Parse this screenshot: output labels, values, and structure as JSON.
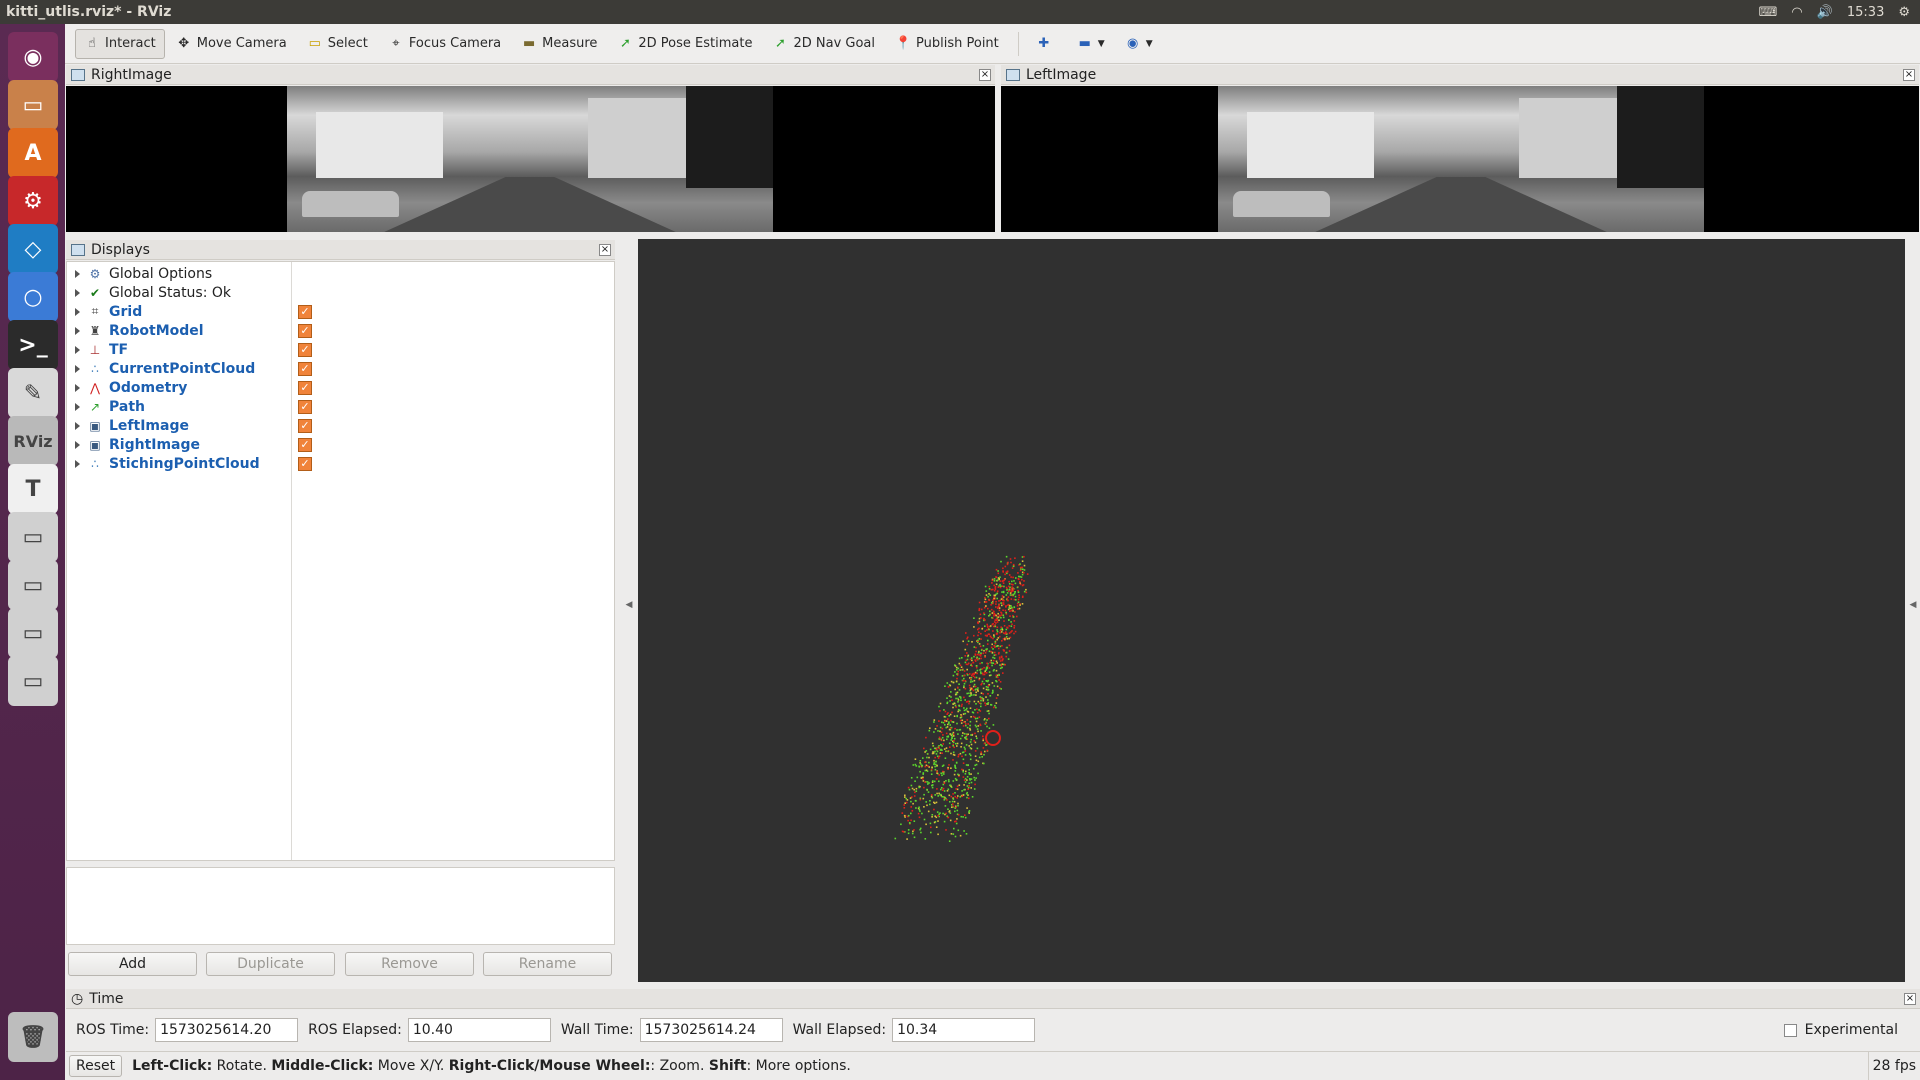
{
  "window": {
    "title": "kitti_utlis.rviz* - RViz"
  },
  "tray": {
    "clock": "15:33",
    "icons": [
      "keyboard-icon",
      "wifi-icon",
      "volume-icon",
      "settings-gear-icon"
    ]
  },
  "launcher": {
    "items": [
      {
        "name": "ubuntu-dash",
        "glyph": "◉",
        "color": "#7a2f5e"
      },
      {
        "name": "files",
        "glyph": "▭",
        "color": "#c9814a"
      },
      {
        "name": "software-center",
        "glyph": "A",
        "color": "#e06a1e"
      },
      {
        "name": "system-settings",
        "glyph": "⚙",
        "color": "#c7282a"
      },
      {
        "name": "vscode",
        "glyph": "◇",
        "color": "#1f7dc4"
      },
      {
        "name": "chromium",
        "glyph": "○",
        "color": "#3b7bd6"
      },
      {
        "name": "terminal",
        "glyph": ">_",
        "color": "#2b2b2b"
      },
      {
        "name": "text-editor",
        "glyph": "✎",
        "color": "#d9d9d9"
      },
      {
        "name": "rviz",
        "glyph": "RViz",
        "color": "#b9b9b9"
      },
      {
        "name": "typora",
        "glyph": "T",
        "color": "#f0f0f0"
      },
      {
        "name": "drive-1",
        "glyph": "▭",
        "color": "#d0d0d0"
      },
      {
        "name": "drive-2",
        "glyph": "▭",
        "color": "#d0d0d0"
      },
      {
        "name": "drive-3",
        "glyph": "▭",
        "color": "#d0d0d0"
      },
      {
        "name": "drive-4",
        "glyph": "▭",
        "color": "#d0d0d0"
      },
      {
        "name": "trash",
        "glyph": "🗑",
        "color": "#bdbdbd"
      }
    ]
  },
  "toolbar": {
    "interact": "Interact",
    "move_camera": "Move Camera",
    "select": "Select",
    "focus_camera": "Focus Camera",
    "measure": "Measure",
    "pose_estimate": "2D Pose Estimate",
    "nav_goal": "2D Nav Goal",
    "publish_point": "Publish Point"
  },
  "right_image_panel": {
    "title": "RightImage"
  },
  "left_image_panel": {
    "title": "LeftImage"
  },
  "displays_panel": {
    "title": "Displays",
    "items": [
      {
        "label": "Global Options",
        "icon": "gear-icon",
        "checkable": false
      },
      {
        "label": "Global Status: Ok",
        "icon": "check-icon",
        "checkable": false
      },
      {
        "label": "Grid",
        "icon": "grid-icon",
        "checkable": true
      },
      {
        "label": "RobotModel",
        "icon": "robot-icon",
        "checkable": true
      },
      {
        "label": "TF",
        "icon": "axes-icon",
        "checkable": true
      },
      {
        "label": "CurrentPointCloud",
        "icon": "pointcloud-icon",
        "checkable": true
      },
      {
        "label": "Odometry",
        "icon": "odometry-icon",
        "checkable": true
      },
      {
        "label": "Path",
        "icon": "path-icon",
        "checkable": true
      },
      {
        "label": "LeftImage",
        "icon": "image-icon",
        "checkable": true
      },
      {
        "label": "RightImage",
        "icon": "image-icon",
        "checkable": true
      },
      {
        "label": "StichingPointCloud",
        "icon": "pointcloud-icon",
        "checkable": true
      }
    ],
    "buttons": {
      "add": "Add",
      "duplicate": "Duplicate",
      "remove": "Remove",
      "rename": "Rename"
    }
  },
  "time_panel": {
    "title": "Time",
    "ros_time_label": "ROS Time:",
    "ros_time": "1573025614.20",
    "ros_elapsed_label": "ROS Elapsed:",
    "ros_elapsed": "10.40",
    "wall_time_label": "Wall Time:",
    "wall_time": "1573025614.24",
    "wall_elapsed_label": "Wall Elapsed:",
    "wall_elapsed": "10.34",
    "experimental_label": "Experimental"
  },
  "status_bar": {
    "reset": "Reset",
    "k1": "Left-Click:",
    "v1": " Rotate. ",
    "k2": "Middle-Click:",
    "v2": " Move X/Y. ",
    "k3": "Right-Click/Mouse Wheel:",
    "v3": ": Zoom. ",
    "k4": "Shift",
    "v4": ": More options.",
    "fps": "28 fps"
  },
  "colors": {
    "render_bg": "#303030",
    "cloud_green": "#5bd82c",
    "cloud_red": "#e0201a",
    "cloud_yellow": "#d9c23a",
    "check_orange": "#f0833a",
    "display_blue": "#1c5fb0"
  }
}
